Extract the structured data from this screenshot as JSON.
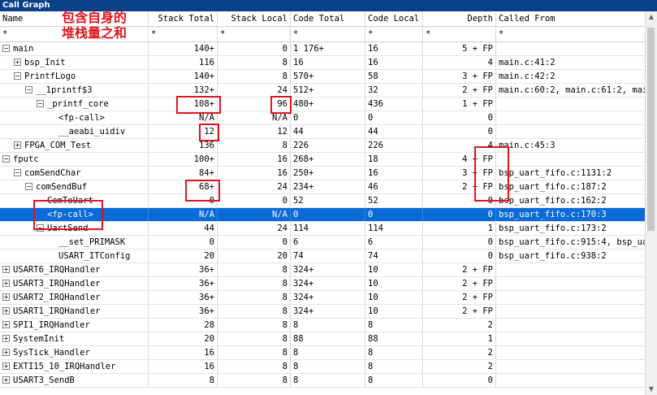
{
  "window": {
    "title": "Call Graph"
  },
  "annotation": {
    "line1": "包含自身的",
    "line2": "堆栈量之和"
  },
  "columns": [
    "Name",
    "Stack Total",
    "Stack Local",
    "Code Total",
    "Code Local",
    "Depth",
    "Called From"
  ],
  "filters": [
    "*",
    "*",
    "*",
    "*",
    "*",
    "*",
    "*"
  ],
  "rows": [
    {
      "indent": 0,
      "toggle": "−",
      "name": "main",
      "stack_total": "140+",
      "stack_local": "0",
      "code_total": "1 176+",
      "code_local": "16",
      "depth": "5 + FP",
      "called_from": ""
    },
    {
      "indent": 1,
      "toggle": "+",
      "name": "bsp_Init",
      "stack_total": "116",
      "stack_local": "8",
      "code_total": "16",
      "code_local": "16",
      "depth": "4",
      "called_from": "main.c:41:2"
    },
    {
      "indent": 1,
      "toggle": "−",
      "name": "PrintfLogo",
      "stack_total": "140+",
      "stack_local": "8",
      "code_total": "570+",
      "code_local": "58",
      "depth": "3 + FP",
      "called_from": "main.c:42:2"
    },
    {
      "indent": 2,
      "toggle": "−",
      "name": "__1printf$3",
      "stack_total": "132+",
      "stack_local": "24",
      "code_total": "512+",
      "code_local": "32",
      "depth": "2 + FP",
      "called_from": "main.c:60:2,  main.c:61:2,  main"
    },
    {
      "indent": 3,
      "toggle": "−",
      "name": "_printf_core",
      "stack_total": "108+",
      "stack_local": "96",
      "code_total": "480+",
      "code_local": "436",
      "depth": "1 + FP",
      "called_from": ""
    },
    {
      "indent": 4,
      "toggle": "",
      "name": "<fp-call>",
      "stack_total": "N/A",
      "stack_local": "N/A",
      "code_total": "0",
      "code_local": "0",
      "depth": "0",
      "called_from": ""
    },
    {
      "indent": 4,
      "toggle": "",
      "name": "__aeabi_uidiv",
      "stack_total": "12",
      "stack_local": "12",
      "code_total": "44",
      "code_local": "44",
      "depth": "0",
      "called_from": ""
    },
    {
      "indent": 1,
      "toggle": "+",
      "name": "FPGA_COM_Test",
      "stack_total": "136",
      "stack_local": "8",
      "code_total": "226",
      "code_local": "226",
      "depth": "4",
      "called_from": "main.c:45:3"
    },
    {
      "indent": 0,
      "toggle": "−",
      "name": "fputc",
      "stack_total": "100+",
      "stack_local": "16",
      "code_total": "268+",
      "code_local": "18",
      "depth": "4 + FP",
      "called_from": ""
    },
    {
      "indent": 1,
      "toggle": "−",
      "name": "comSendChar",
      "stack_total": "84+",
      "stack_local": "16",
      "code_total": "250+",
      "code_local": "16",
      "depth": "3 + FP",
      "called_from": "bsp_uart_fifo.c:1131:2"
    },
    {
      "indent": 2,
      "toggle": "−",
      "name": "comSendBuf",
      "stack_total": "68+",
      "stack_local": "24",
      "code_total": "234+",
      "code_local": "46",
      "depth": "2 + FP",
      "called_from": "bsp_uart_fifo.c:187:2"
    },
    {
      "indent": 3,
      "toggle": "",
      "name": "ComToUart",
      "stack_total": "0",
      "stack_local": "0",
      "code_total": "52",
      "code_local": "52",
      "depth": "0",
      "called_from": "bsp_uart_fifo.c:162:2"
    },
    {
      "indent": 3,
      "toggle": "",
      "name": "<fp-call>",
      "stack_total": "N/A",
      "stack_local": "N/A",
      "code_total": "0",
      "code_local": "0",
      "depth": "0",
      "called_from": "bsp_uart_fifo.c:170:3",
      "selected": true
    },
    {
      "indent": 3,
      "toggle": "−",
      "name": "UartSend",
      "stack_total": "44",
      "stack_local": "24",
      "code_total": "114",
      "code_local": "114",
      "depth": "1",
      "called_from": "bsp_uart_fifo.c:173:2"
    },
    {
      "indent": 4,
      "toggle": "",
      "name": "__set_PRIMASK",
      "stack_total": "0",
      "stack_local": "0",
      "code_total": "6",
      "code_local": "6",
      "depth": "0",
      "called_from": "bsp_uart_fifo.c:915:4,  bsp_uar"
    },
    {
      "indent": 4,
      "toggle": "",
      "name": "USART_ITConfig",
      "stack_total": "20",
      "stack_local": "20",
      "code_total": "74",
      "code_local": "74",
      "depth": "0",
      "called_from": "bsp_uart_fifo.c:938:2"
    },
    {
      "indent": 0,
      "toggle": "+",
      "name": "USART6_IRQHandler",
      "stack_total": "36+",
      "stack_local": "8",
      "code_total": "324+",
      "code_local": "10",
      "depth": "2 + FP",
      "called_from": ""
    },
    {
      "indent": 0,
      "toggle": "+",
      "name": "USART3_IRQHandler",
      "stack_total": "36+",
      "stack_local": "8",
      "code_total": "324+",
      "code_local": "10",
      "depth": "2 + FP",
      "called_from": ""
    },
    {
      "indent": 0,
      "toggle": "+",
      "name": "USART2_IRQHandler",
      "stack_total": "36+",
      "stack_local": "8",
      "code_total": "324+",
      "code_local": "10",
      "depth": "2 + FP",
      "called_from": ""
    },
    {
      "indent": 0,
      "toggle": "+",
      "name": "USART1_IRQHandler",
      "stack_total": "36+",
      "stack_local": "8",
      "code_total": "324+",
      "code_local": "10",
      "depth": "2 + FP",
      "called_from": ""
    },
    {
      "indent": 0,
      "toggle": "+",
      "name": "SPI1_IRQHandler",
      "stack_total": "28",
      "stack_local": "8",
      "code_total": "8",
      "code_local": "8",
      "depth": "2",
      "called_from": ""
    },
    {
      "indent": 0,
      "toggle": "+",
      "name": "SystemInit",
      "stack_total": "20",
      "stack_local": "8",
      "code_total": "88",
      "code_local": "88",
      "depth": "1",
      "called_from": ""
    },
    {
      "indent": 0,
      "toggle": "+",
      "name": "SysTick_Handler",
      "stack_total": "16",
      "stack_local": "8",
      "code_total": "8",
      "code_local": "8",
      "depth": "2",
      "called_from": ""
    },
    {
      "indent": 0,
      "toggle": "+",
      "name": "EXTI15_10_IRQHandler",
      "stack_total": "16",
      "stack_local": "8",
      "code_total": "8",
      "code_local": "8",
      "depth": "2",
      "called_from": ""
    },
    {
      "indent": 0,
      "toggle": "+",
      "name": "USART3_SendB",
      "stack_total": "8",
      "stack_local": "8",
      "code_total": "8",
      "code_local": "8",
      "depth": "0",
      "called_from": ""
    }
  ]
}
